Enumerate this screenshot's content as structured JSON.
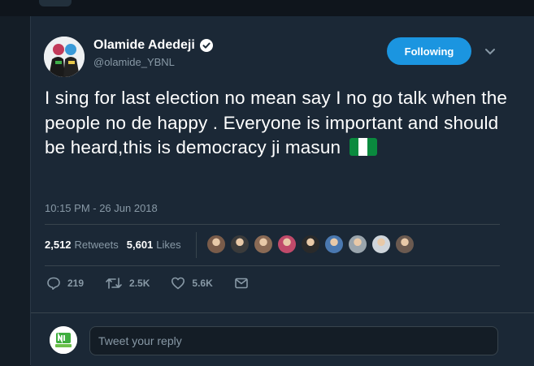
{
  "tweet": {
    "author_name": "Olamide Adedeji",
    "handle": "@olamide_YBNL",
    "follow_label": "Following",
    "text": "I sing for last election no mean say I no go talk when the people no de happy . Everyone is important and should be heard,this is democracy ji masun",
    "flag_emoji": "nigeria-flag",
    "timestamp": "10:15 PM - 26 Jun 2018"
  },
  "stats": {
    "retweets_count": "2,512",
    "retweets_label": "Retweets",
    "likes_count": "5,601",
    "likes_label": "Likes",
    "liker_colors": [
      "#7a5c4a",
      "#3b3b3b",
      "#8a6a55",
      "#c04a6a",
      "#2a2a2a",
      "#4a78b0",
      "#9aa5ad",
      "#cfd5db",
      "#6b5a50"
    ]
  },
  "actions": {
    "replies": "219",
    "retweets": "2.5K",
    "likes": "5.6K"
  },
  "reply": {
    "placeholder": "Tweet your reply"
  },
  "colors": {
    "background": "#141d26",
    "card": "#1b2836",
    "accent": "#1b95e0",
    "muted": "#8899a6"
  }
}
